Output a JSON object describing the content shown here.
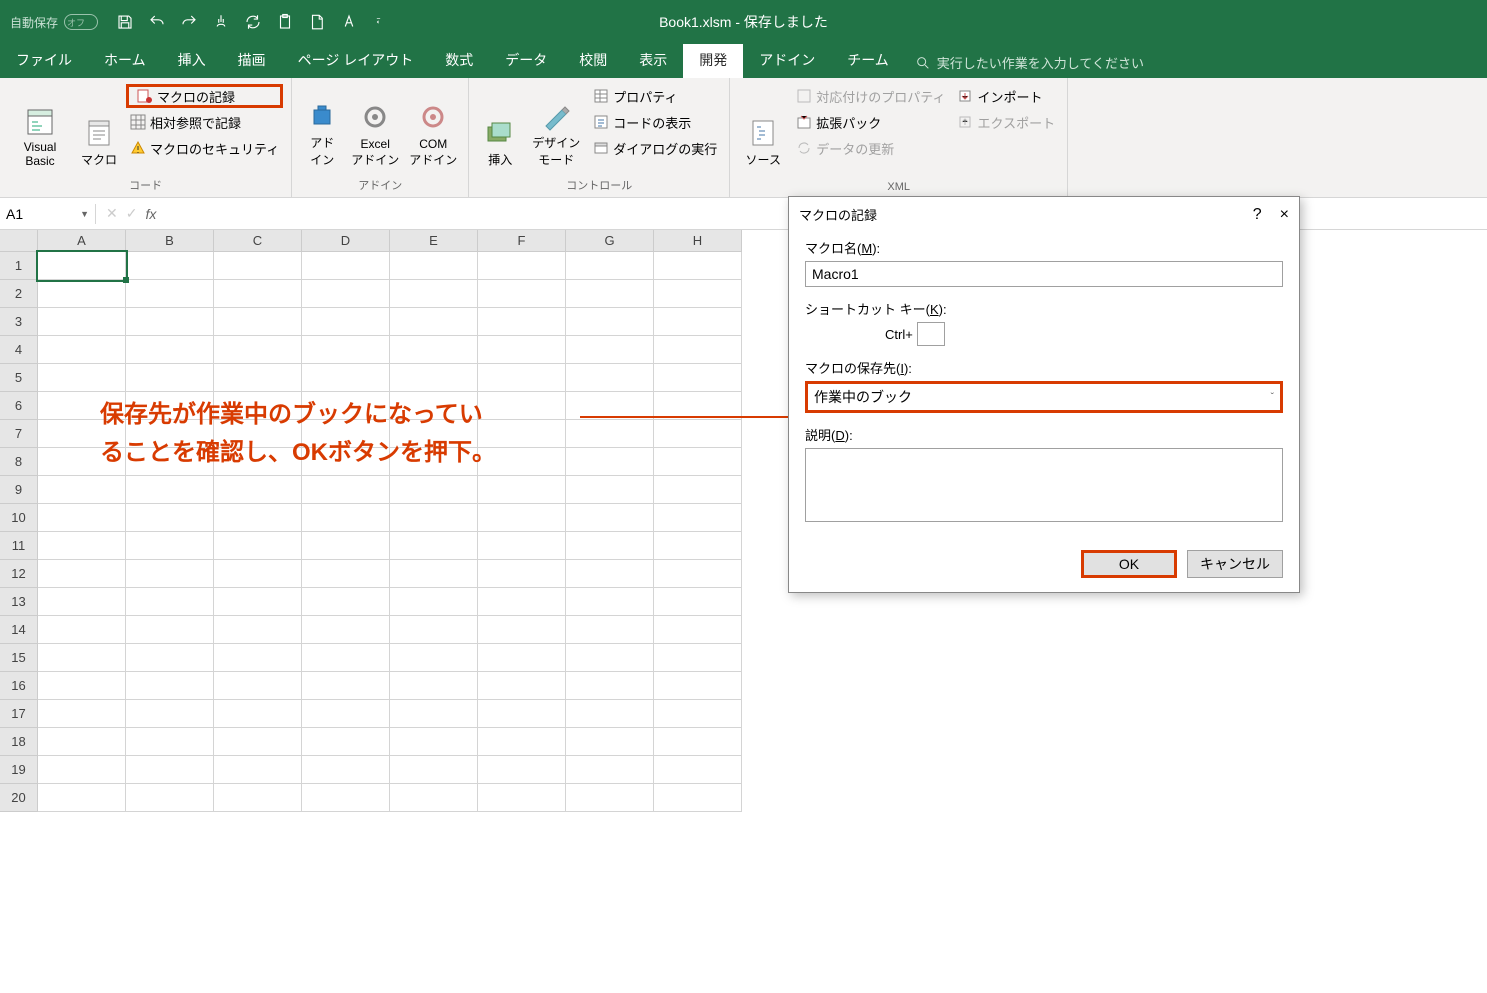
{
  "titlebar": {
    "autosave_label": "自動保存",
    "autosave_state": "オフ",
    "filename": "Book1.xlsm",
    "status_suffix": " - 保存しました"
  },
  "tabs": {
    "file": "ファイル",
    "home": "ホーム",
    "insert": "挿入",
    "draw": "描画",
    "layout": "ページ レイアウト",
    "formulas": "数式",
    "data": "データ",
    "review": "校閲",
    "view": "表示",
    "developer": "開発",
    "addins": "アドイン",
    "team": "チーム",
    "tellme": "実行したい作業を入力してください"
  },
  "ribbon": {
    "vb": "Visual Basic",
    "macros": "マクロ",
    "record": "マクロの記録",
    "relative": "相対参照で記録",
    "security": "マクロのセキュリティ",
    "code_group": "コード",
    "addin": "アド\nイン",
    "excel_addin": "Excel\nアドイン",
    "com_addin": "COM\nアドイン",
    "addins_group": "アドイン",
    "ins": "挿入",
    "design": "デザイン\nモード",
    "prop": "プロパティ",
    "viewcode": "コードの表示",
    "rundlg": "ダイアログの実行",
    "controls_group": "コントロール",
    "source": "ソース",
    "map_props": "対応付けのプロパティ",
    "expansion": "拡張パック",
    "refresh": "データの更新",
    "import": "インポート",
    "export": "エクスポート",
    "xml_group": "XML"
  },
  "formulabar": {
    "namebox": "A1"
  },
  "columns": [
    "A",
    "B",
    "C",
    "D",
    "E",
    "F",
    "G",
    "H"
  ],
  "rows": [
    "1",
    "2",
    "3",
    "4",
    "5",
    "6",
    "7",
    "8",
    "9",
    "10",
    "11",
    "12",
    "13",
    "14",
    "15",
    "16",
    "17",
    "18",
    "19",
    "20"
  ],
  "annotation": {
    "line1": "保存先が作業中のブックになってい",
    "line2": "ることを確認し、OKボタンを押下。"
  },
  "dialog": {
    "title": "マクロの記録",
    "name_label_pre": "マクロ名(",
    "name_label_u": "M",
    "name_label_post": "):",
    "name_value": "Macro1",
    "shortcut_label_pre": "ショートカット キー(",
    "shortcut_label_u": "K",
    "shortcut_label_post": "):",
    "shortcut_prefix": "Ctrl+",
    "save_label_pre": "マクロの保存先(",
    "save_label_u": "I",
    "save_label_post": "):",
    "save_value": "作業中のブック",
    "desc_label_pre": "説明(",
    "desc_label_u": "D",
    "desc_label_post": "):",
    "ok": "OK",
    "cancel": "キャンセル",
    "help": "?",
    "close": "×"
  }
}
